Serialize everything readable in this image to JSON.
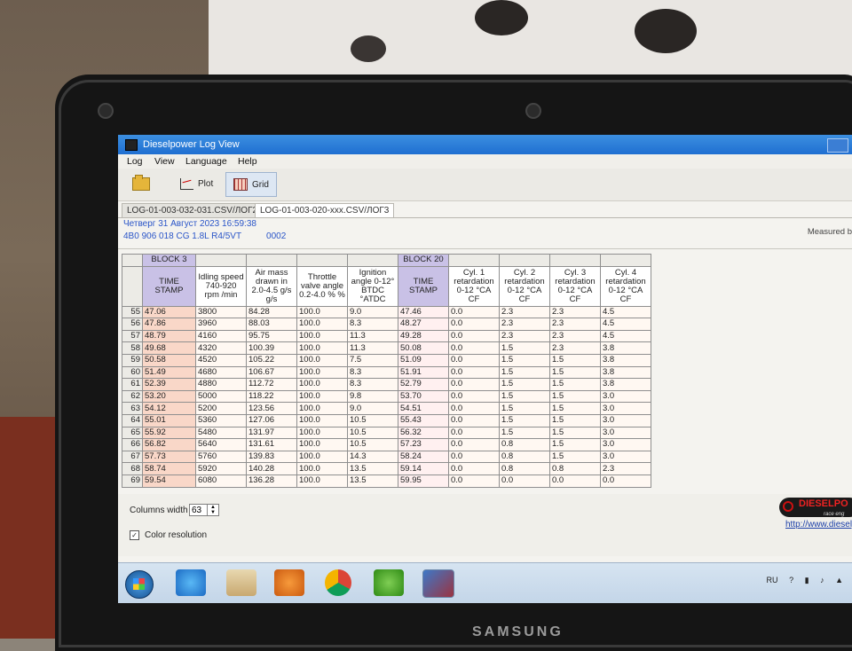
{
  "window": {
    "title": "Dieselpower Log View",
    "menu": [
      "Log",
      "View",
      "Language",
      "Help"
    ]
  },
  "toolbar": {
    "open_icon": "folder-open-icon",
    "plot_label": "Plot",
    "grid_label": "Grid"
  },
  "tabs": [
    {
      "label": "LOG-01-003-032-031.CSV/ЛОГ2"
    },
    {
      "label": "LOG-01-003-020-xxx.CSV/ЛОГ3"
    }
  ],
  "info": {
    "datetime": "Четверг 31 Август 2023 16:59:38",
    "ecu": "4B0 906 018 CG  1.8L R4/5VT",
    "code": "0002",
    "measured": "Measured b"
  },
  "grid": {
    "block_labels": [
      "BLOCK 3",
      "BLOCK 20"
    ],
    "headers": [
      "TIME STAMP",
      "Idling speed 740-920 rpm /min",
      "Air mass drawn in 2.0-4.5 g/s g/s",
      "Throttle valve angle 0.2-4.0 % %",
      "Ignition angle 0-12° BTDC °ATDC",
      "TIME STAMP",
      "Cyl. 1 retardation 0-12 °CA CF",
      "Cyl. 2 retardation 0-12 °CA CF",
      "Cyl. 3 retardation 0-12 °CA CF",
      "Cyl. 4 retardation 0-12 °CA CF"
    ],
    "rows": [
      [
        "55",
        "47.06",
        "3800",
        "84.28",
        "100.0",
        "9.0",
        "47.46",
        "0.0",
        "2.3",
        "2.3",
        "4.5"
      ],
      [
        "56",
        "47.86",
        "3960",
        "88.03",
        "100.0",
        "8.3",
        "48.27",
        "0.0",
        "2.3",
        "2.3",
        "4.5"
      ],
      [
        "57",
        "48.79",
        "4160",
        "95.75",
        "100.0",
        "11.3",
        "49.28",
        "0.0",
        "2.3",
        "2.3",
        "4.5"
      ],
      [
        "58",
        "49.68",
        "4320",
        "100.39",
        "100.0",
        "11.3",
        "50.08",
        "0.0",
        "1.5",
        "2.3",
        "3.8"
      ],
      [
        "59",
        "50.58",
        "4520",
        "105.22",
        "100.0",
        "7.5",
        "51.09",
        "0.0",
        "1.5",
        "1.5",
        "3.8"
      ],
      [
        "60",
        "51.49",
        "4680",
        "106.67",
        "100.0",
        "8.3",
        "51.91",
        "0.0",
        "1.5",
        "1.5",
        "3.8"
      ],
      [
        "61",
        "52.39",
        "4880",
        "112.72",
        "100.0",
        "8.3",
        "52.79",
        "0.0",
        "1.5",
        "1.5",
        "3.8"
      ],
      [
        "62",
        "53.20",
        "5000",
        "118.22",
        "100.0",
        "9.8",
        "53.70",
        "0.0",
        "1.5",
        "1.5",
        "3.0"
      ],
      [
        "63",
        "54.12",
        "5200",
        "123.56",
        "100.0",
        "9.0",
        "54.51",
        "0.0",
        "1.5",
        "1.5",
        "3.0"
      ],
      [
        "64",
        "55.01",
        "5360",
        "127.06",
        "100.0",
        "10.5",
        "55.43",
        "0.0",
        "1.5",
        "1.5",
        "3.0"
      ],
      [
        "65",
        "55.92",
        "5480",
        "131.97",
        "100.0",
        "10.5",
        "56.32",
        "0.0",
        "1.5",
        "1.5",
        "3.0"
      ],
      [
        "66",
        "56.82",
        "5640",
        "131.61",
        "100.0",
        "10.5",
        "57.23",
        "0.0",
        "0.8",
        "1.5",
        "3.0"
      ],
      [
        "67",
        "57.73",
        "5760",
        "139.83",
        "100.0",
        "14.3",
        "58.24",
        "0.0",
        "0.8",
        "1.5",
        "3.0"
      ],
      [
        "68",
        "58.74",
        "5920",
        "140.28",
        "100.0",
        "13.5",
        "59.14",
        "0.0",
        "0.8",
        "0.8",
        "2.3"
      ],
      [
        "69",
        "59.54",
        "6080",
        "136.28",
        "100.0",
        "13.5",
        "59.95",
        "0.0",
        "0.0",
        "0.0",
        "0.0"
      ]
    ]
  },
  "bottom": {
    "columns_width_label": "Columns width",
    "columns_width_value": "63",
    "color_resolution_label": "Color resolution",
    "color_resolution_checked": true,
    "logo_text": "DIESELPO",
    "logo_sub": "race eng",
    "url": "http://www.dieselp"
  },
  "taskbar": {
    "lang": "RU",
    "icons": [
      "start-orb-icon",
      "ie-icon",
      "library-icon",
      "media-player-icon",
      "chrome-icon",
      "utorrent-icon",
      "log-view-icon"
    ]
  },
  "bezel": {
    "brand": "SAMSUNG"
  }
}
